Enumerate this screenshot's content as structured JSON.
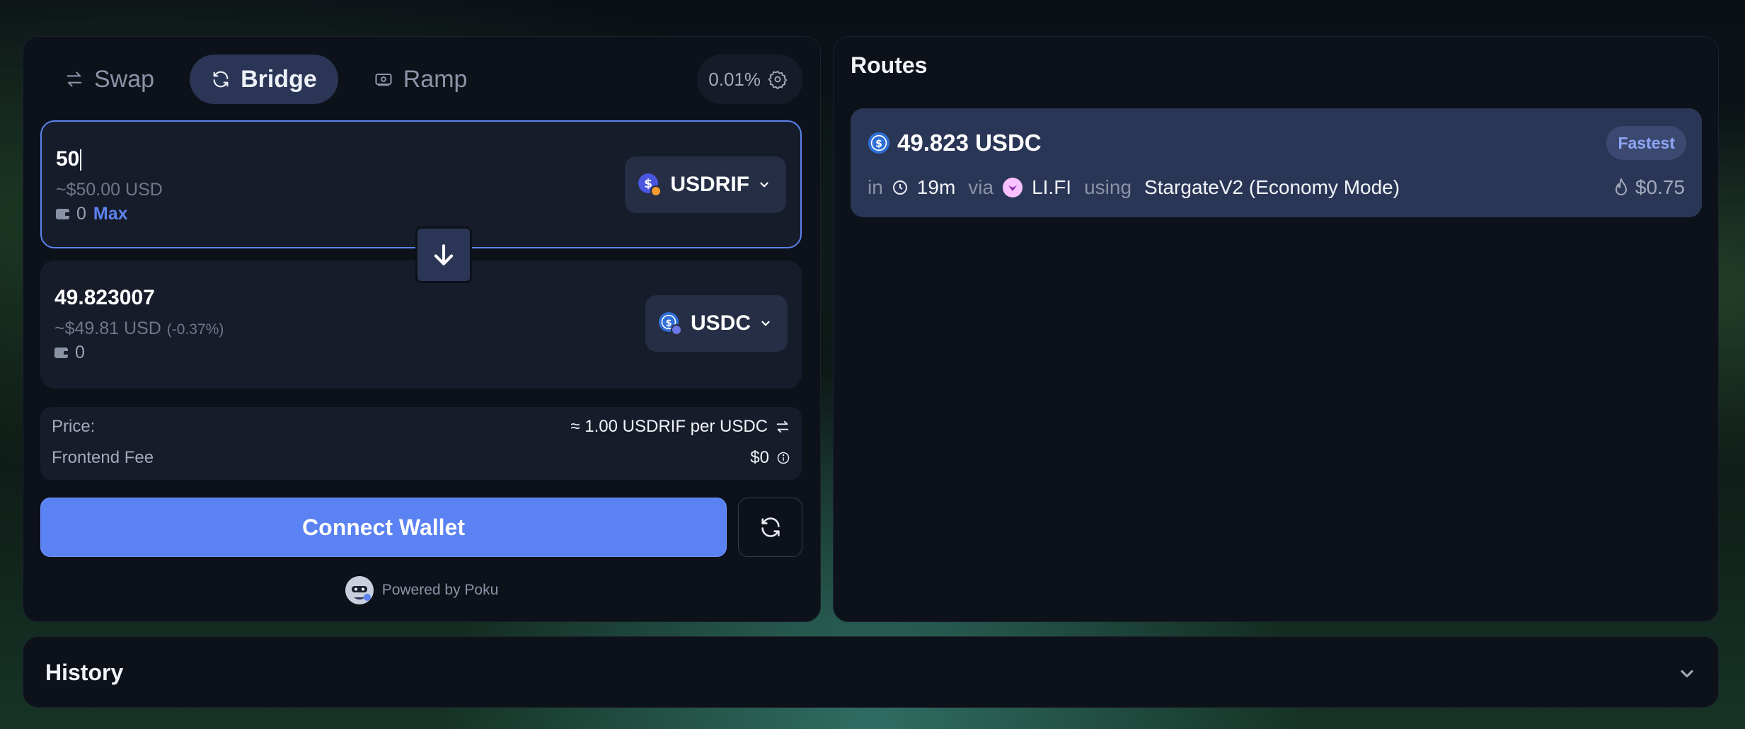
{
  "tabs": [
    {
      "label": "Swap",
      "icon": "arrows-exchange-icon",
      "active": false
    },
    {
      "label": "Bridge",
      "icon": "refresh-arrows-icon",
      "active": true
    },
    {
      "label": "Ramp",
      "icon": "banknote-icon",
      "active": false
    }
  ],
  "slippage": {
    "value": "0.01%",
    "icon": "gear-icon"
  },
  "from": {
    "amount": "50",
    "usd": "~$50.00 USD",
    "balance": "0",
    "max_label": "Max",
    "token": "USDRIF"
  },
  "to": {
    "amount": "49.823007",
    "usd": "~$49.81 USD",
    "pct": "(-0.37%)",
    "balance": "0",
    "token": "USDC"
  },
  "info": {
    "price_label": "Price:",
    "price_value": "≈ 1.00 USDRIF per USDC",
    "fee_label": "Frontend Fee",
    "fee_value": "$0"
  },
  "connect_label": "Connect Wallet",
  "powered_by": "Powered by Poku",
  "routes": {
    "title": "Routes",
    "card": {
      "amount": "49.823 USDC",
      "badge": "Fastest",
      "in_label": "in",
      "time": "19m",
      "via_label": "via",
      "provider": "LI.FI",
      "using_label": "using",
      "bridge": "StargateV2 (Economy Mode)",
      "gas": "$0.75"
    }
  },
  "history": {
    "title": "History"
  },
  "colors": {
    "accent": "#5a82f2",
    "panel": "#0d1119",
    "route_card": "#2a3656",
    "badge_text": "#8fa6f5"
  }
}
